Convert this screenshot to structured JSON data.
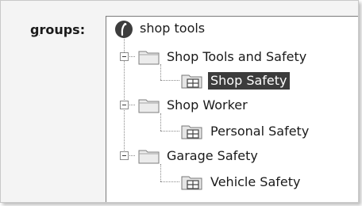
{
  "field": {
    "label_first": "g",
    "label_rest": "roups:"
  },
  "tree": {
    "root": {
      "label": "shop tools",
      "icon": "root-globe-icon"
    },
    "groups": [
      {
        "label": "Shop Tools and Safety",
        "icon": "folder-icon",
        "expanded": true,
        "children": [
          {
            "label": "Shop Safety",
            "icon": "grid-group-icon",
            "selected": true
          }
        ]
      },
      {
        "label": "Shop Worker",
        "icon": "folder-icon",
        "expanded": true,
        "children": [
          {
            "label": "Personal Safety",
            "icon": "grid-group-icon",
            "selected": false
          }
        ]
      },
      {
        "label": "Garage Safety",
        "icon": "folder-icon",
        "expanded": true,
        "children": [
          {
            "label": "Vehicle Safety",
            "icon": "grid-group-icon",
            "selected": false
          }
        ]
      }
    ]
  }
}
